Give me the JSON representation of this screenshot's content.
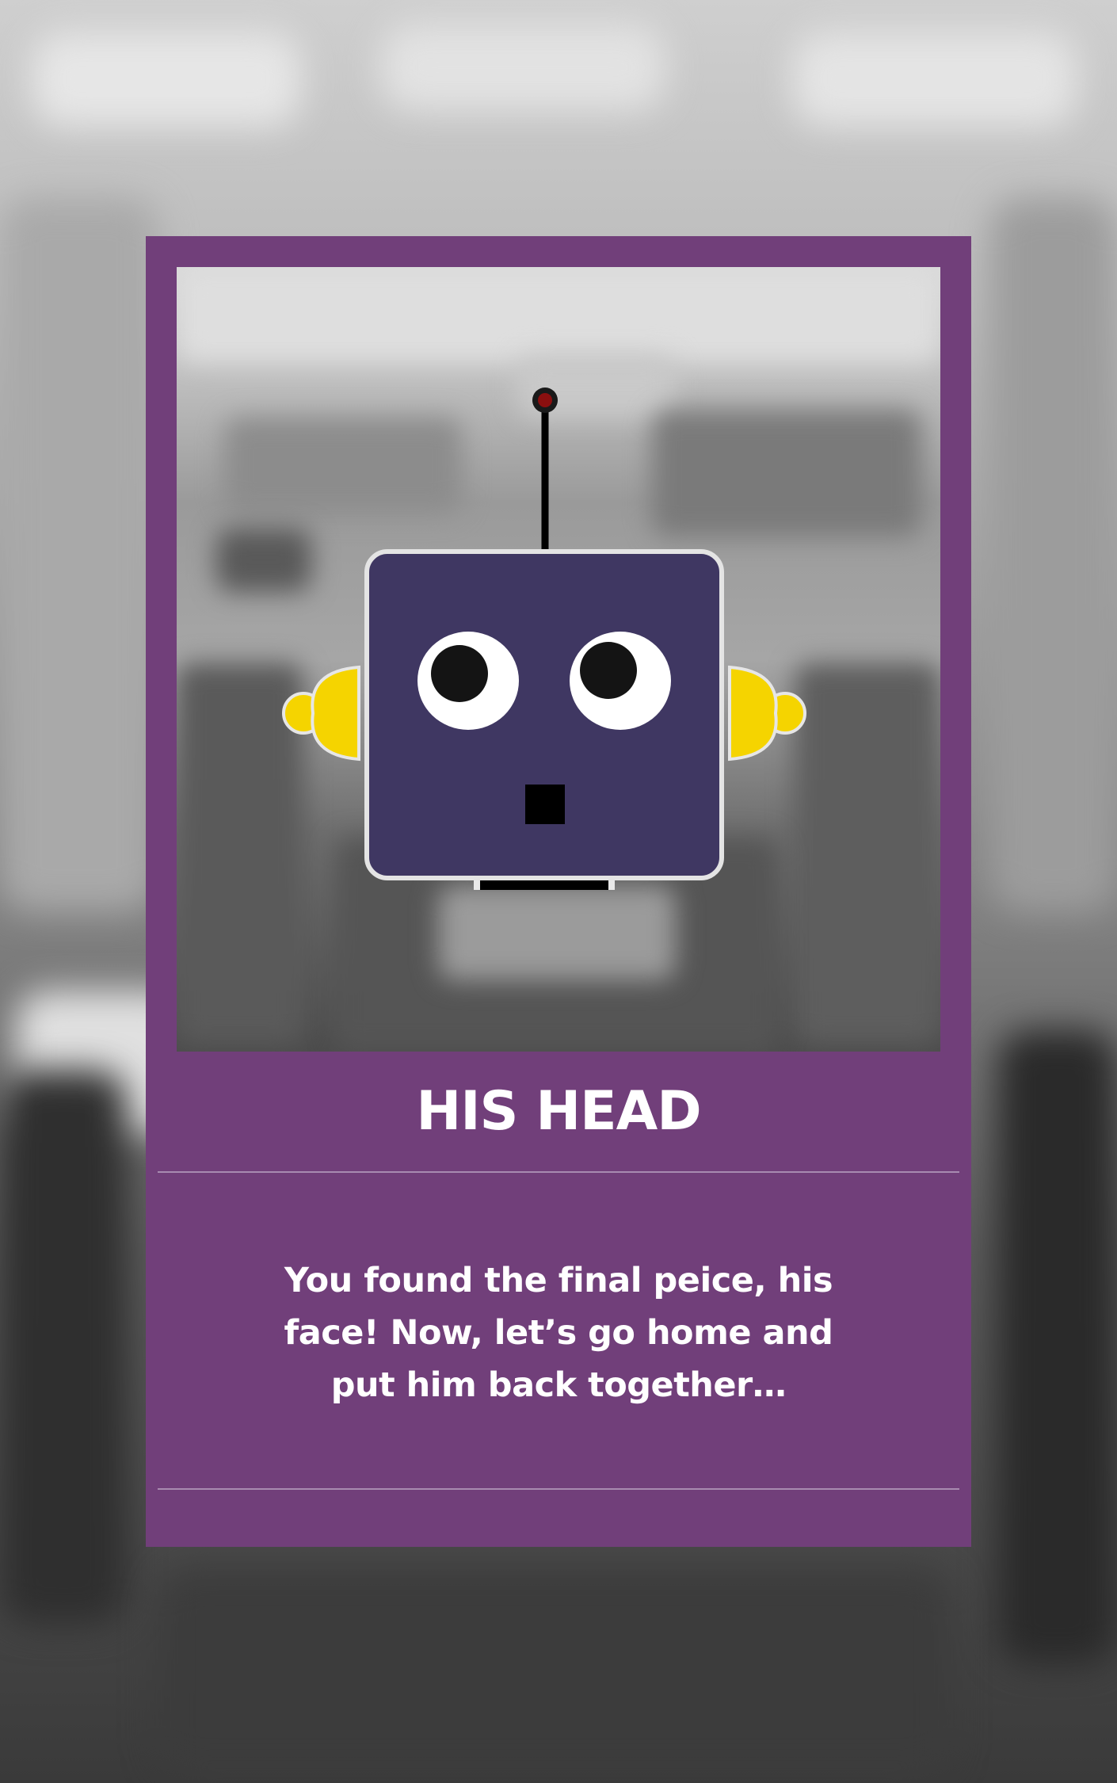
{
  "card": {
    "title": "HIS HEAD",
    "message": "You found the final peice, his face! Now, let’s go home and put him back together…"
  },
  "colors": {
    "card_background": "#713f7a",
    "robot_face": "#3f3762",
    "robot_ears": "#f5d400",
    "antenna_tip": "#8b0f0f"
  },
  "icons": {
    "robot": "robot-head-icon"
  }
}
